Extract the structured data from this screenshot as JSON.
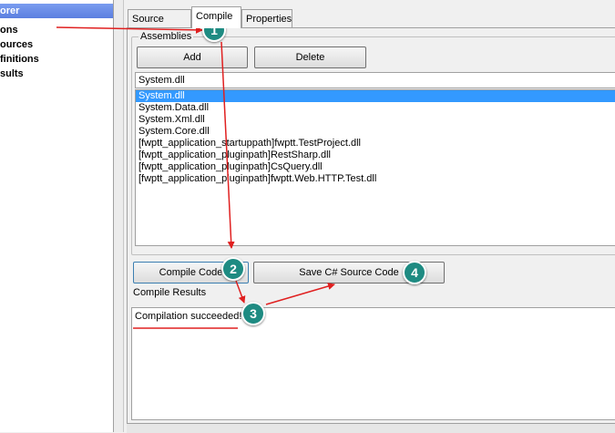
{
  "explorer": {
    "title": "orer",
    "items": [
      "ons",
      "ources",
      "finitions",
      "sults"
    ]
  },
  "tabs": [
    {
      "label": "Source Code",
      "active": false
    },
    {
      "label": "Compile",
      "active": true
    },
    {
      "label": "Properties",
      "active": false
    }
  ],
  "assemblies": {
    "group_label": "Assemblies",
    "add_label": "Add",
    "delete_label": "Delete",
    "input_value": "System.dll",
    "items": [
      "System.dll",
      "System.Data.dll",
      "System.Xml.dll",
      "System.Core.dll",
      "[fwptt_application_startuppath]fwptt.TestProject.dll",
      "[fwptt_application_pluginpath]RestSharp.dll",
      "[fwptt_application_pluginpath]CsQuery.dll",
      "[fwptt_application_pluginpath]fwptt.Web.HTTP.Test.dll"
    ],
    "selected_index": 0
  },
  "actions": {
    "compile_label": "Compile Code",
    "save_label": "Save C# Source Code"
  },
  "results": {
    "label": "Compile Results",
    "text": "Compilation succeeded!"
  },
  "annotations": {
    "badges": [
      "1",
      "2",
      "3",
      "4"
    ],
    "accent_color": "#1e8b82",
    "arrow_color": "#e02020"
  }
}
